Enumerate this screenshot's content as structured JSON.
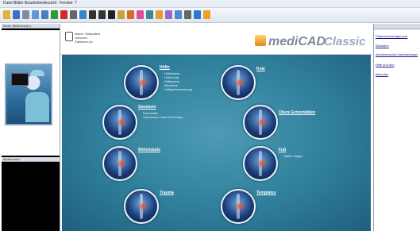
{
  "menubar": {
    "items": [
      "Datei",
      "Bilder",
      "Bearbeiten",
      "Ansicht",
      "Fenster",
      "?"
    ]
  },
  "toolbar": {
    "icons": [
      {
        "name": "open-folder-icon",
        "color": "#e2b23a"
      },
      {
        "name": "save-icon",
        "color": "#3a6fc9"
      },
      {
        "name": "print-icon",
        "color": "#7b8da3"
      },
      {
        "name": "scan-icon",
        "color": "#5a9bd1"
      },
      {
        "name": "zoom-icon",
        "color": "#4b7cc0"
      },
      {
        "name": "add-icon",
        "color": "#2a9a3a"
      },
      {
        "name": "delete-icon",
        "color": "#d02a2a"
      },
      {
        "name": "move-icon",
        "color": "#666666"
      },
      {
        "name": "image-icon",
        "color": "#3a86c8"
      },
      {
        "name": "line-icon",
        "color": "#333333"
      },
      {
        "name": "angle-icon",
        "color": "#333333"
      },
      {
        "name": "text-icon",
        "color": "#222222"
      },
      {
        "name": "ruler-icon",
        "color": "#c9a23a"
      },
      {
        "name": "circle-icon",
        "color": "#d66a2a"
      },
      {
        "name": "color-icon",
        "color": "#e24a9a"
      },
      {
        "name": "measure-icon",
        "color": "#3a8a9a"
      },
      {
        "name": "template-icon",
        "color": "#e2a02a"
      },
      {
        "name": "implant-icon",
        "color": "#9a6ac2"
      },
      {
        "name": "report-icon",
        "color": "#4a8ad2"
      },
      {
        "name": "settings-icon",
        "color": "#666666"
      },
      {
        "name": "help-icon",
        "color": "#2a7ad2"
      },
      {
        "name": "info-icon",
        "color": "#f0a020"
      }
    ]
  },
  "left_panel": {
    "title": "Bilder (Bildbrowser)",
    "bottom_title": "Bildbrowser"
  },
  "header": {
    "patient_lines": [
      "Name: Testpatient",
      "Geboren:",
      "Patienten-Nr.:"
    ],
    "brand_main": "mediCAD",
    "brand_suffix": "Classic",
    "brand_color_main": "#7f8a99",
    "brand_color_suffix": "#9aaac4"
  },
  "modules": [
    {
      "label": "Hüfte",
      "subs": [
        "Hüftpfanne",
        "Hüftschaft",
        "Hüftgelenk",
        "Biometrie",
        "Hüftgelenkmessung"
      ]
    },
    {
      "label": "Knie",
      "subs": []
    },
    {
      "label": "Ganzbein",
      "subs": [
        "Deformität",
        "Osteotomie nach Dror Paley"
      ]
    },
    {
      "label": "Obere Extremitäten",
      "subs": []
    },
    {
      "label": "Wirbelsäule",
      "subs": []
    },
    {
      "label": "Fuß",
      "subs": [
        "Hallux Valgus"
      ]
    },
    {
      "label": "Trauma",
      "subs": []
    },
    {
      "label": "Templates",
      "subs": []
    }
  ],
  "right_panel": {
    "links": [
      "Patientenmanagement",
      "Bilddaten",
      "Aufnahmemodus Voreinstellungen",
      "Hilfe und Info",
      "Beenden"
    ]
  }
}
